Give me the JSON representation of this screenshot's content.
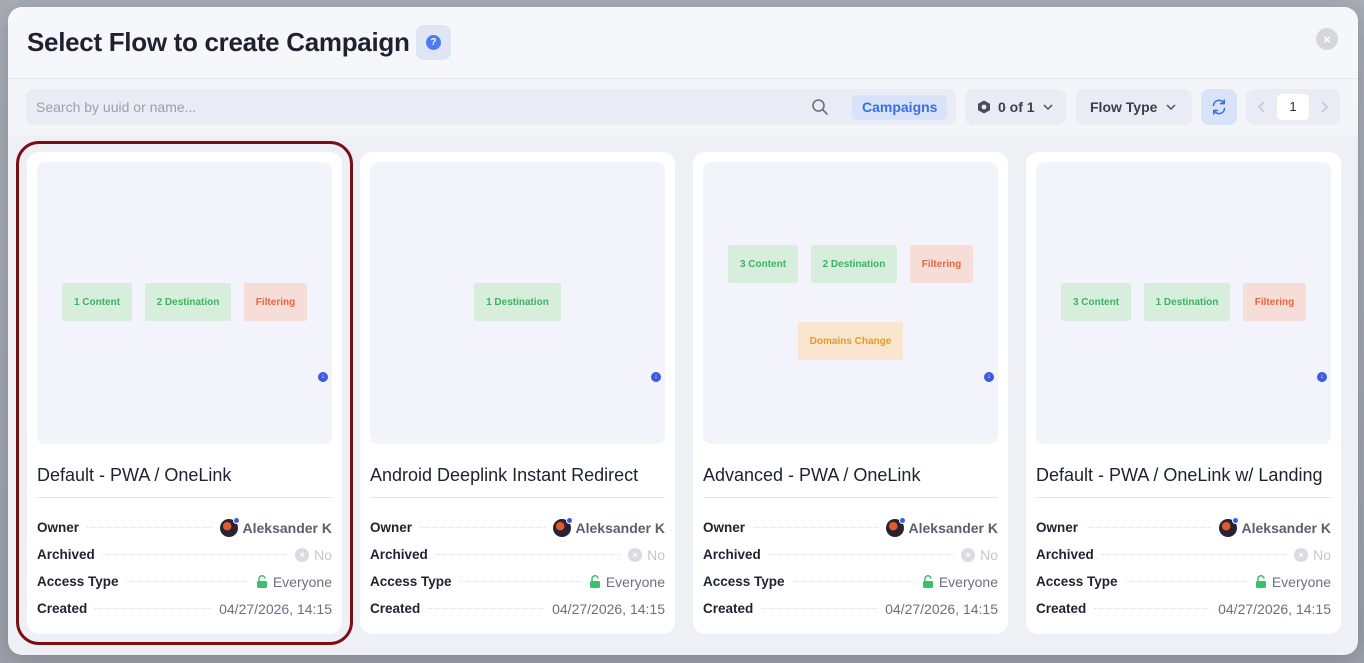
{
  "modal": {
    "title": "Select Flow to create Campaign",
    "help_icon": "question-icon",
    "close_icon": "close-icon"
  },
  "toolbar": {
    "search_placeholder": "Search by uuid or name...",
    "campaigns_chip": "Campaigns",
    "count_label": "0 of 1",
    "flow_type_label": "Flow Type",
    "page": "1",
    "accent": "#3b6fe0"
  },
  "labels": {
    "owner": "Owner",
    "archived": "Archived",
    "access_type": "Access Type",
    "created": "Created"
  },
  "cards": [
    {
      "title": "Default - PWA / OneLink",
      "owner": "Aleksander K",
      "archived": "No",
      "access": "Everyone",
      "created": "04/27/2026, 14:15",
      "nodes": [
        "1 Content",
        "2 Destination",
        "Filtering"
      ],
      "selected": true
    },
    {
      "title": "Android Deeplink Instant Redirect",
      "owner": "Aleksander K",
      "archived": "No",
      "access": "Everyone",
      "created": "04/27/2026, 14:15",
      "nodes": [
        "1 Destination"
      ]
    },
    {
      "title": "Advanced - PWA / OneLink",
      "owner": "Aleksander K",
      "archived": "No",
      "access": "Everyone",
      "created": "04/27/2026, 14:15",
      "nodes": [
        "3 Content",
        "2 Destination",
        "Filtering",
        "Domains Change"
      ]
    },
    {
      "title": "Default - PWA / OneLink w/ Landing",
      "owner": "Aleksander K",
      "archived": "No",
      "access": "Everyone",
      "created": "04/27/2026, 14:15",
      "nodes": [
        "3 Content",
        "1 Destination",
        "Filtering"
      ]
    }
  ]
}
